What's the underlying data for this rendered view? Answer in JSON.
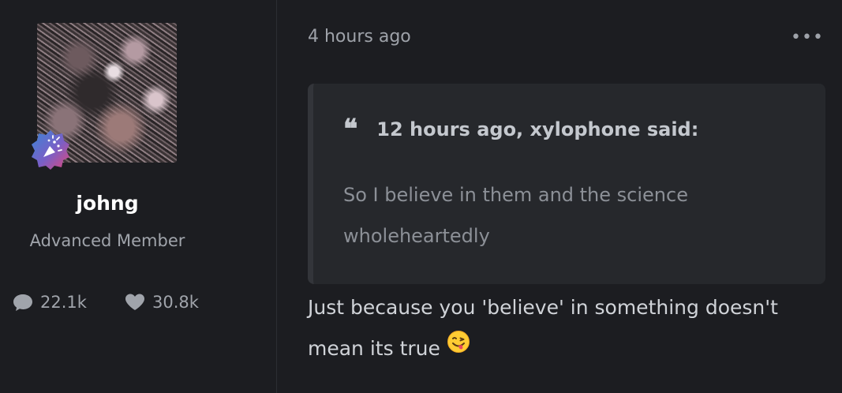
{
  "author": {
    "username": "johng",
    "rank": "Advanced Member",
    "avatar_icon": "user-avatar",
    "badge_icon": "party-popper-badge-icon",
    "stats": {
      "posts": "22.1k",
      "reputation": "30.8k"
    }
  },
  "post": {
    "timestamp": "4 hours ago",
    "menu_icon": "more-options-icon",
    "quote": {
      "header": "12 hours ago, xylophone said:",
      "text": "So I believe in them and the science wholeheartedly"
    },
    "body": "Just because you 'believe' in something doesn't mean its true",
    "emoji": "face-savoring-food-emoji"
  },
  "colors": {
    "background": "#1c1d21",
    "quote_background": "#26282c",
    "username": "#ffffff",
    "muted_text": "#a0a4ab"
  }
}
